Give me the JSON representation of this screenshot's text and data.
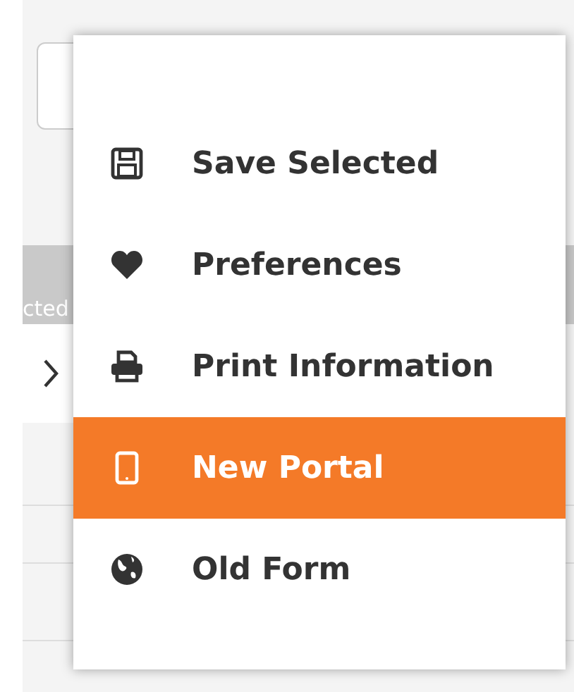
{
  "background": {
    "bar_text": "cted"
  },
  "menu": {
    "items": [
      {
        "label": "Save Selected",
        "selected": false
      },
      {
        "label": "Preferences",
        "selected": false
      },
      {
        "label": "Print Information",
        "selected": false
      },
      {
        "label": "New Portal",
        "selected": true
      },
      {
        "label": "Old Form",
        "selected": false
      }
    ]
  }
}
